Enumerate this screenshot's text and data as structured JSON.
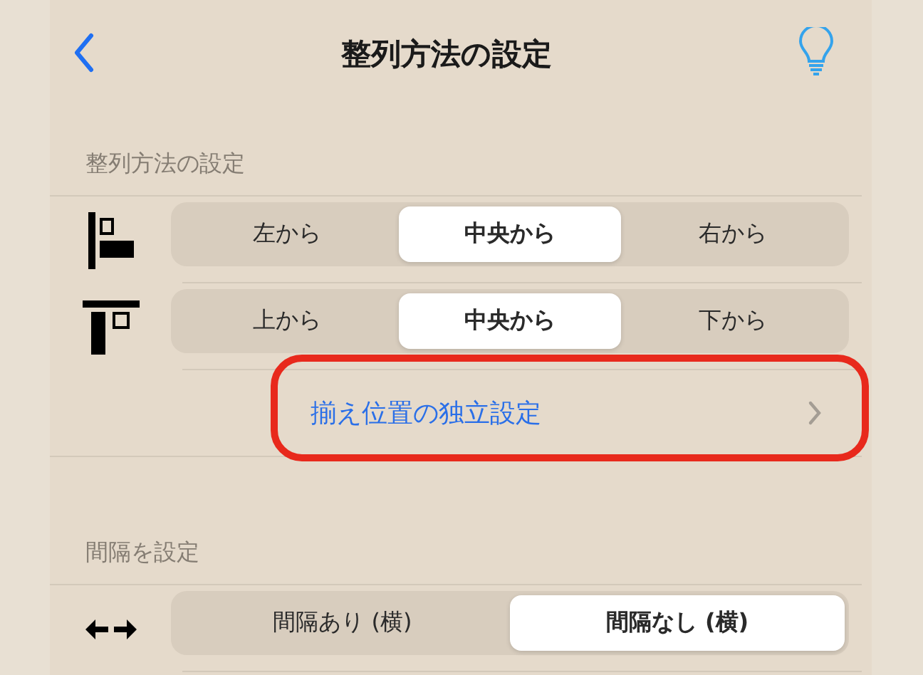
{
  "nav": {
    "title": "整列方法の設定"
  },
  "sections": [
    {
      "header": "整列方法の設定",
      "rows": [
        {
          "kind": "segmented",
          "options": [
            {
              "label": "左から",
              "selected": false
            },
            {
              "label": "中央から",
              "selected": true
            },
            {
              "label": "右から",
              "selected": false
            }
          ]
        },
        {
          "kind": "segmented",
          "options": [
            {
              "label": "上から",
              "selected": false
            },
            {
              "label": "中央から",
              "selected": true
            },
            {
              "label": "下から",
              "selected": false
            }
          ]
        },
        {
          "kind": "link",
          "label": "揃え位置の独立設定",
          "highlighted": true
        }
      ]
    },
    {
      "header": "間隔を設定",
      "rows": [
        {
          "kind": "segmented",
          "options": [
            {
              "label": "間隔あり (横)",
              "selected": false
            },
            {
              "label": "間隔なし (横)",
              "selected": true
            }
          ]
        }
      ]
    }
  ]
}
